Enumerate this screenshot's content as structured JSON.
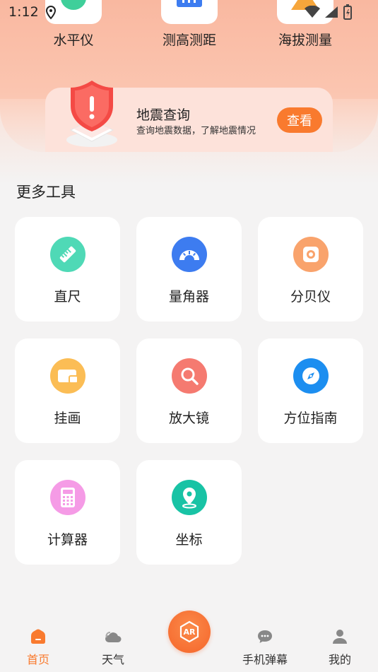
{
  "status": {
    "time": "1:12"
  },
  "top_tools": [
    {
      "label": "水平仪"
    },
    {
      "label": "测高测距"
    },
    {
      "label": "海拔测量"
    }
  ],
  "quake": {
    "title": "地震查询",
    "subtitle": "查询地震数据，了解地震情况",
    "button": "查看"
  },
  "section_title": "更多工具",
  "tools": [
    {
      "label": "直尺",
      "icon": "ruler-icon",
      "color": "#4fd9b6"
    },
    {
      "label": "量角器",
      "icon": "protractor-icon",
      "color": "#3d7cf0"
    },
    {
      "label": "分贝仪",
      "icon": "decibel-icon",
      "color": "#f9a36c"
    },
    {
      "label": "挂画",
      "icon": "picture-frame-icon",
      "color": "#fbbd55"
    },
    {
      "label": "放大镜",
      "icon": "magnifier-icon",
      "color": "#f57a70"
    },
    {
      "label": "方位指南",
      "icon": "compass-icon",
      "color": "#1c8ef0"
    },
    {
      "label": "计算器",
      "icon": "calculator-icon",
      "color": "#f59be6"
    },
    {
      "label": "坐标",
      "icon": "location-pin-icon",
      "color": "#18c3a5"
    }
  ],
  "nav": {
    "home": "首页",
    "weather": "天气",
    "barrage": "手机弹幕",
    "mine": "我的",
    "accent": "#f97a2e"
  }
}
